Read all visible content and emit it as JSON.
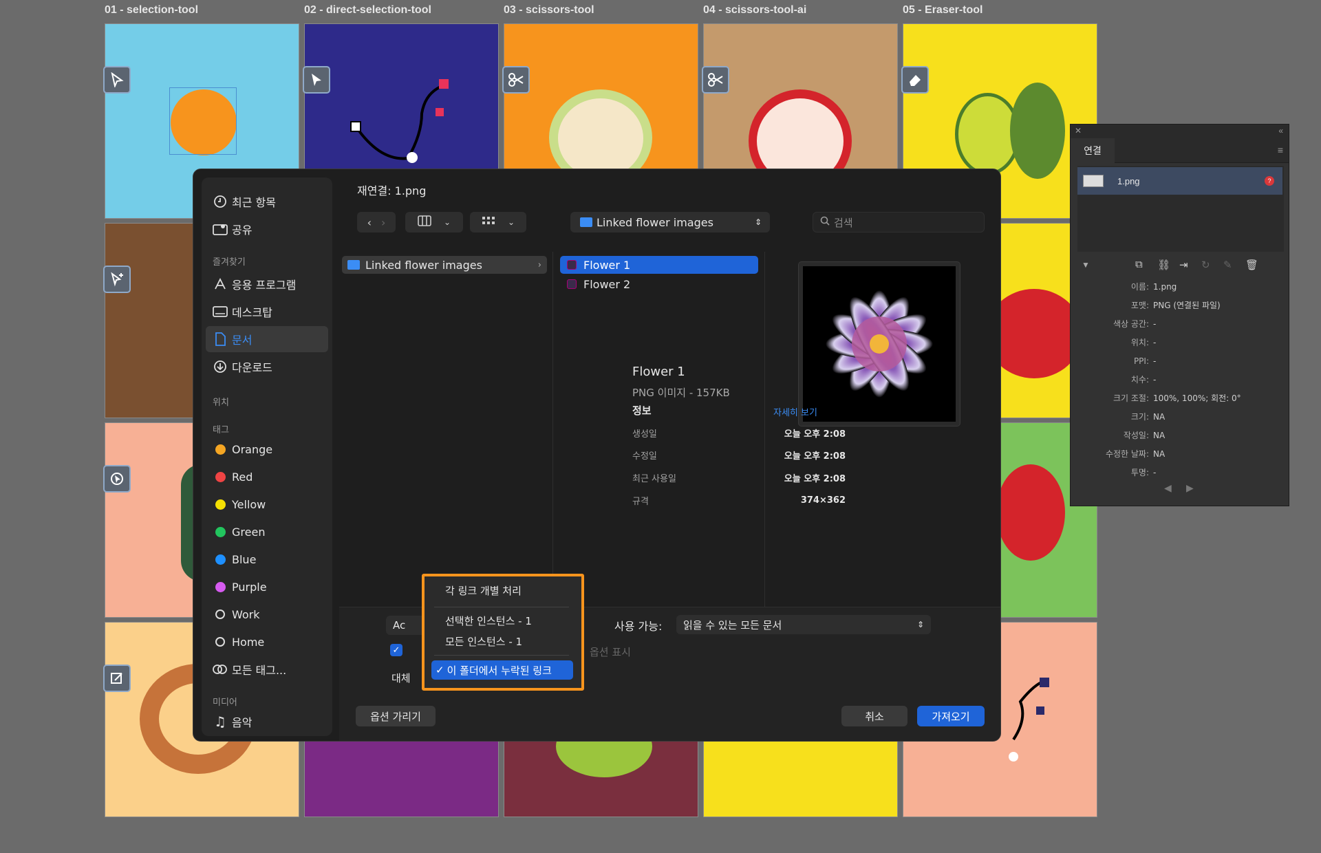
{
  "artboards": {
    "labels": [
      "01 - selection-tool",
      "02 - direct-selection-tool",
      "03 - scissors-tool",
      "04 - scissors-tool-ai",
      "05 - Eraser-tool"
    ]
  },
  "colors": {
    "accent": "#1f64d8",
    "highlight_border": "#f7941d",
    "row_selected": "#1f64d8"
  },
  "links_panel": {
    "tab": "연결",
    "item_name": "1.png",
    "info": [
      {
        "k": "이름:",
        "v": "1.png"
      },
      {
        "k": "포맷:",
        "v": "PNG (연결된 파일)"
      },
      {
        "k": "색상 공간:",
        "v": "-"
      },
      {
        "k": "위치:",
        "v": "-"
      },
      {
        "k": "PPI:",
        "v": "-"
      },
      {
        "k": "치수:",
        "v": "-"
      },
      {
        "k": "크기 조절:",
        "v": "100%, 100%; 회전: 0°"
      },
      {
        "k": "크기:",
        "v": "NA"
      },
      {
        "k": "작성일:",
        "v": "NA"
      },
      {
        "k": "수정한 날짜:",
        "v": "NA"
      },
      {
        "k": "투명:",
        "v": "-"
      }
    ]
  },
  "dialog": {
    "title": "재연결: 1.png",
    "path": "Linked flower images",
    "search_placeholder": "검색",
    "sidebar": {
      "recents": "최근 항목",
      "shared": "공유",
      "favorites_head": "즐겨찾기",
      "apps": "응용 프로그램",
      "desktop": "데스크탑",
      "documents": "문서",
      "downloads": "다운로드",
      "locations_head": "위치",
      "tags_head": "태그",
      "tags": [
        {
          "label": "Orange",
          "color": "#f5a623"
        },
        {
          "label": "Red",
          "color": "#ef4444"
        },
        {
          "label": "Yellow",
          "color": "#f5e003"
        },
        {
          "label": "Green",
          "color": "#22c55e"
        },
        {
          "label": "Blue",
          "color": "#1e90ff"
        },
        {
          "label": "Purple",
          "color": "#d65bf0"
        },
        {
          "label": "Work",
          "color": ""
        },
        {
          "label": "Home",
          "color": ""
        }
      ],
      "all_tags": "모든 태그...",
      "media_head": "미디어",
      "music": "음악"
    },
    "folder_column": "Linked flower images",
    "files": [
      "Flower 1",
      "Flower 2"
    ],
    "preview": {
      "name": "Flower 1",
      "kind": "PNG 이미지 - 157KB",
      "info_head": "정보",
      "more": "자세히 보기",
      "rows": [
        {
          "k": "생성일",
          "v": "오늘 오후 2:08"
        },
        {
          "k": "수정일",
          "v": "오늘 오후 2:08"
        },
        {
          "k": "최근 사용일",
          "v": "오늘 오후 2:08"
        },
        {
          "k": "규격",
          "v": "374×362"
        }
      ]
    },
    "enable_label": "사용 가능:",
    "enable_value": "읽을 수 있는 모든 문서",
    "show_options": "옵션 표시",
    "partial_ac": "Ac",
    "partial_replace": "대체",
    "hide_options": "옵션 가리기",
    "cancel": "취소",
    "import": "가져오기"
  },
  "popup_menu": {
    "items": [
      "각 링크 개별 처리",
      "선택한 인스턴스 - 1",
      "모든 인스턴스 - 1",
      "이 폴더에서 누락된 링크"
    ],
    "selected_index": 3,
    "check": "✓"
  }
}
